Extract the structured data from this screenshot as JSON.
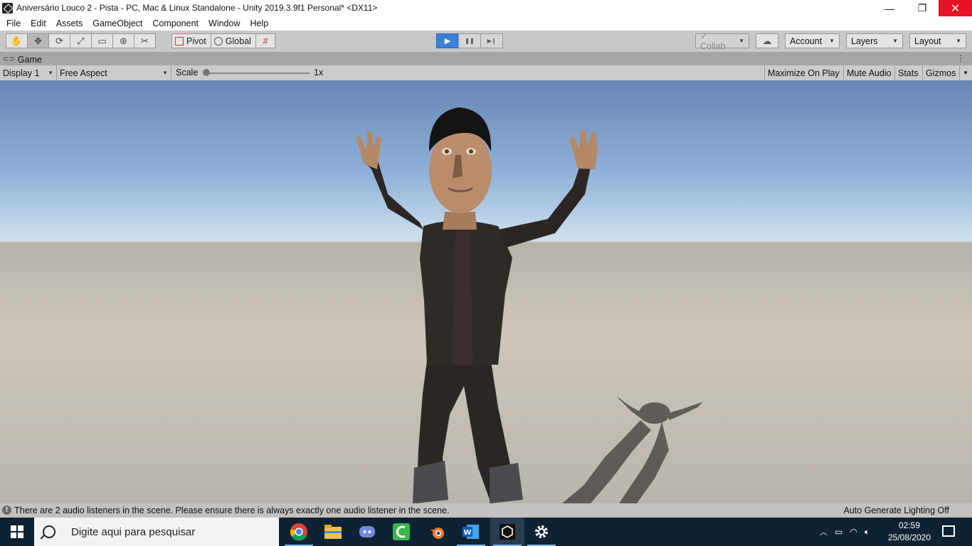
{
  "window": {
    "title": "Aniversário Louco 2 - Pista - PC, Mac & Linux Standalone - Unity 2019.3.9f1 Personal* <DX11>",
    "minimize": "—",
    "maximize": "❐",
    "close": "✕"
  },
  "menu": [
    "File",
    "Edit",
    "Assets",
    "GameObject",
    "Component",
    "Window",
    "Help"
  ],
  "toolbar": {
    "tools": [
      "✋",
      "✥",
      "⟳",
      "⤢",
      "▭",
      "⊛",
      "✂"
    ],
    "pivot_label": "Pivot",
    "global_label": "Global",
    "snap_icon": "#",
    "play_icon": "▶",
    "pause_icon": "❚❚",
    "step_icon": "▶❙",
    "collab_label": "✓ Collab",
    "cloud_icon": "☁",
    "account_label": "Account",
    "layers_label": "Layers",
    "layout_label": "Layout"
  },
  "game_tab": {
    "label": "Game",
    "display": "Display 1",
    "aspect": "Free Aspect",
    "scale_label": "Scale",
    "scale_value": "1x",
    "maximize": "Maximize On Play",
    "mute": "Mute Audio",
    "stats": "Stats",
    "gizmos": "Gizmos"
  },
  "status": {
    "message": "There are 2 audio listeners in the scene. Please ensure there is always exactly one audio listener in the scene.",
    "lighting": "Auto Generate Lighting Off"
  },
  "taskbar": {
    "search_placeholder": "Digite aqui para pesquisar",
    "apps": [
      "chrome-icon",
      "file-explorer-icon",
      "discord-icon",
      "camtasia-icon",
      "blender-icon",
      "word-icon",
      "unity-icon",
      "settings-icon"
    ],
    "time": "02:59",
    "date": "25/08/2020"
  },
  "colors": {
    "play_active": "#3d7ed6",
    "close_red": "#e81123",
    "taskbar": "#0f2233"
  }
}
